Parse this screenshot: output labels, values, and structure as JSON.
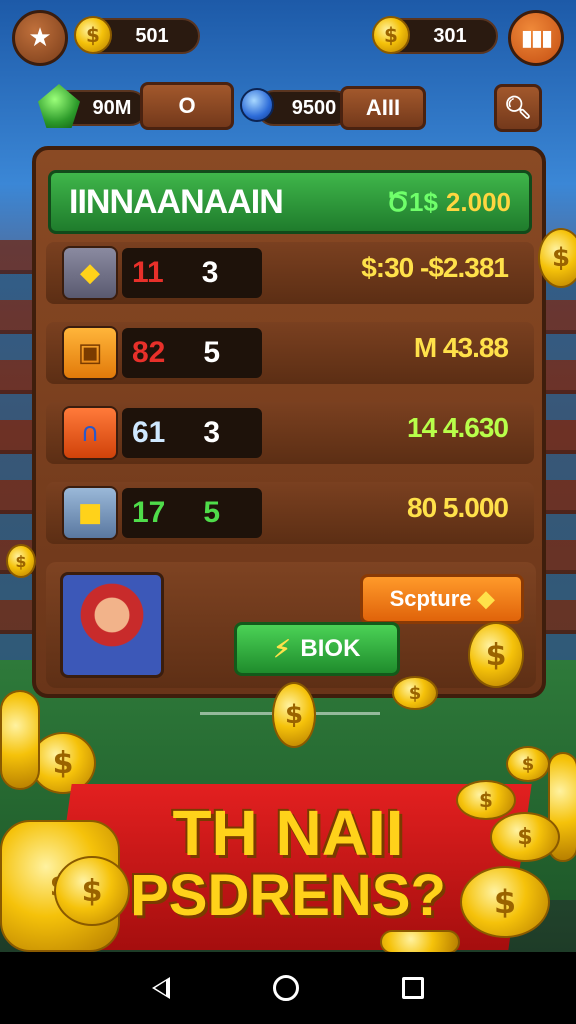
{
  "hud": {
    "coins_left": "501",
    "coins_right": "301",
    "gems_value": "90M",
    "gems_button": "O",
    "shield_value": "9500",
    "shield_button": "AIII",
    "coin_symbol": "$"
  },
  "panel": {
    "title": "IINNAANAAIN",
    "amount_symbol": "Ծ1$",
    "amount": "2.000",
    "rows": [
      {
        "icon": "gold-block-icon",
        "num_a": "11",
        "num_b": "3",
        "value": "$:30 -$2.381",
        "color_a": "#e8302a",
        "value_color": "#ffe14a"
      },
      {
        "icon": "treasure-icon",
        "num_a": "82",
        "num_b": "5",
        "value": "M 43.88",
        "color_a": "#e8302a",
        "value_color": "#ffe14a"
      },
      {
        "icon": "magnet-icon",
        "num_a": "61",
        "num_b": "3",
        "value": "14 4.630",
        "color_a": "#cfe8ff",
        "value_color": "#b8ff4a"
      },
      {
        "icon": "cube-icon",
        "num_a": "17",
        "num_b": "5",
        "value": "80 5.000",
        "color_a": "#4fdc4a",
        "value_color": "#ffe14a"
      }
    ],
    "capture_label": "Scpture",
    "book_label": "BIOK"
  },
  "banner": {
    "line1": "TH NAII",
    "line2": "PSDRENS?"
  },
  "colors": {
    "accent_green": "#2aa53a",
    "accent_orange": "#f07a14",
    "wood": "#7a4020",
    "banner_red": "#d81818"
  }
}
